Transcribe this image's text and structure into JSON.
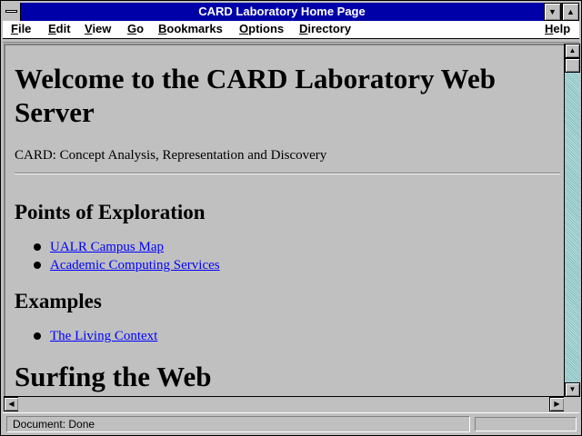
{
  "window": {
    "title": "CARD Laboratory Home Page"
  },
  "menu": {
    "items": [
      {
        "accel": "F",
        "rest": "ile"
      },
      {
        "accel": "E",
        "rest": "dit"
      },
      {
        "accel": "V",
        "rest": "iew"
      },
      {
        "accel": "G",
        "rest": "o"
      },
      {
        "accel": "B",
        "rest": "ookmarks"
      },
      {
        "accel": "O",
        "rest": "ptions"
      },
      {
        "accel": "D",
        "rest": "irectory"
      },
      {
        "accel": "H",
        "rest": "elp"
      }
    ]
  },
  "page": {
    "heading": "Welcome to the CARD Laboratory Web Server",
    "tagline": "CARD: Concept Analysis, Representation and Discovery",
    "section1": {
      "title": "Points of Exploration",
      "links": [
        "UALR Campus Map",
        "Academic Computing Services"
      ]
    },
    "section2": {
      "title": "Examples",
      "links": [
        "The Living Context"
      ]
    },
    "section3": {
      "title": "Surfing the Web"
    }
  },
  "status": {
    "text": "Document: Done"
  },
  "colors": {
    "titlebar": "#0000a8",
    "link": "#0000ff",
    "background": "#c0c0c0"
  }
}
